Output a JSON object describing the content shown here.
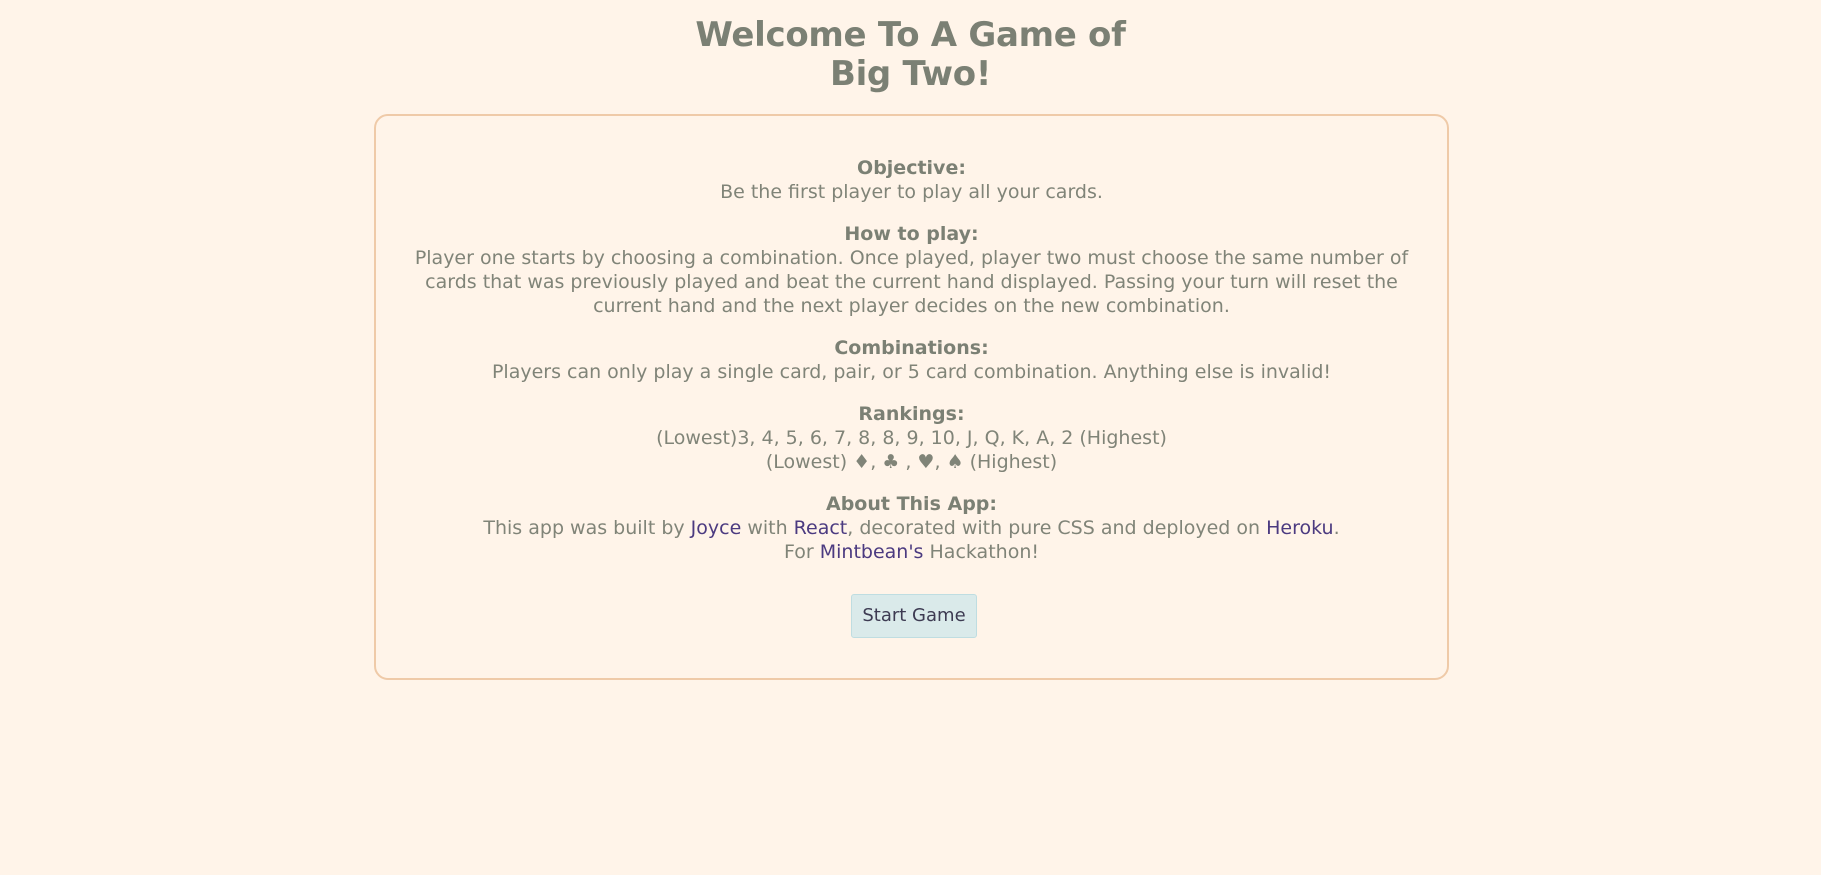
{
  "header": {
    "title_line1": "Welcome To A Game of",
    "title_line2": "Big Two!"
  },
  "objective": {
    "heading": "Objective:",
    "text": "Be the first player to play all your cards."
  },
  "how_to_play": {
    "heading": "How to play:",
    "lines": [
      "Player one starts by choosing a combination. Once played, player two must choose the same number of",
      "cards that was previously played and beat the current hand displayed. Passing your turn will reset the",
      "current hand and the next player decides on the new combination."
    ]
  },
  "combinations": {
    "heading": "Combinations:",
    "text": "Players can only play a single card, pair, or 5 card combination. Anything else is invalid!"
  },
  "rankings": {
    "heading": "Rankings:",
    "values_line": "(Lowest)3, 4, 5, 6, 7, 8, 8, 9, 10, J, Q, K, A, 2 (Highest)",
    "suits_line": "(Lowest) ♦, ♣ , ♥, ♠ (Highest)"
  },
  "about": {
    "heading": "About This App:",
    "t1": "This app was built by ",
    "link_joyce": "Joyce",
    "t2": " with ",
    "link_react": "React",
    "t3": ", decorated with pure CSS and deployed on ",
    "link_heroku": "Heroku",
    "t4": ".",
    "t5": "For ",
    "link_mintbean": "Mintbean's",
    "t6": " Hackathon!"
  },
  "actions": {
    "start_label": "Start Game"
  },
  "colors": {
    "background": "#fff4e9",
    "text": "#808478",
    "border": "#efcaa8",
    "link": "#4b3a80",
    "button_bg": "#daeaea"
  }
}
